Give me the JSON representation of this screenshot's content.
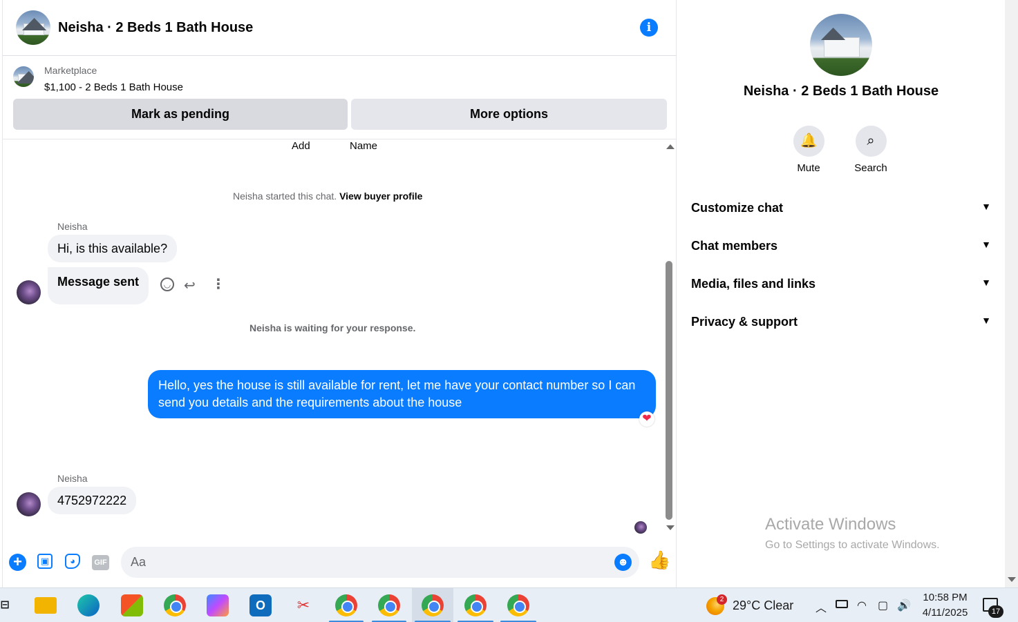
{
  "chat": {
    "title": "Neisha · 2 Beds 1 Bath House",
    "listing": {
      "source": "Marketplace",
      "price_title": "$1,100 - 2 Beds 1 Bath House"
    },
    "buttons": {
      "pending": "Mark as pending",
      "more": "More options"
    },
    "header_labels": {
      "add": "Add",
      "name": "Name"
    },
    "system": {
      "started_prefix": "Neisha started this chat.",
      "started_link": "View buyer profile",
      "waiting": "Neisha is waiting for your response."
    },
    "messages": [
      {
        "sender": "Neisha",
        "text": "Hi, is this available?"
      },
      {
        "text": "Message sent"
      },
      {
        "text": "Hello, yes the house is still available for rent, let me have your contact number so I can send you details and the requirements about the house"
      },
      {
        "sender": "Neisha",
        "text": "4752972222"
      }
    ],
    "composer": {
      "placeholder": "Aa",
      "gif": "GIF"
    }
  },
  "info_panel": {
    "title": "Neisha · 2 Beds 1 Bath House",
    "actions": [
      {
        "label": "Mute",
        "icon": "bell-icon"
      },
      {
        "label": "Search",
        "icon": "search-icon"
      }
    ],
    "sections": [
      "Customize chat",
      "Chat members",
      "Media, files and links",
      "Privacy & support"
    ]
  },
  "watermark": {
    "title": "Activate Windows",
    "subtitle": "Go to Settings to activate Windows."
  },
  "taskbar": {
    "weather": "29°C  Clear",
    "weather_badge": "2",
    "time": "10:58 PM",
    "date": "4/11/2025",
    "notifications": "17"
  },
  "colors": {
    "accent": "#0a7cff",
    "heart": "#f02849",
    "taskbar": "#e8eef6"
  }
}
